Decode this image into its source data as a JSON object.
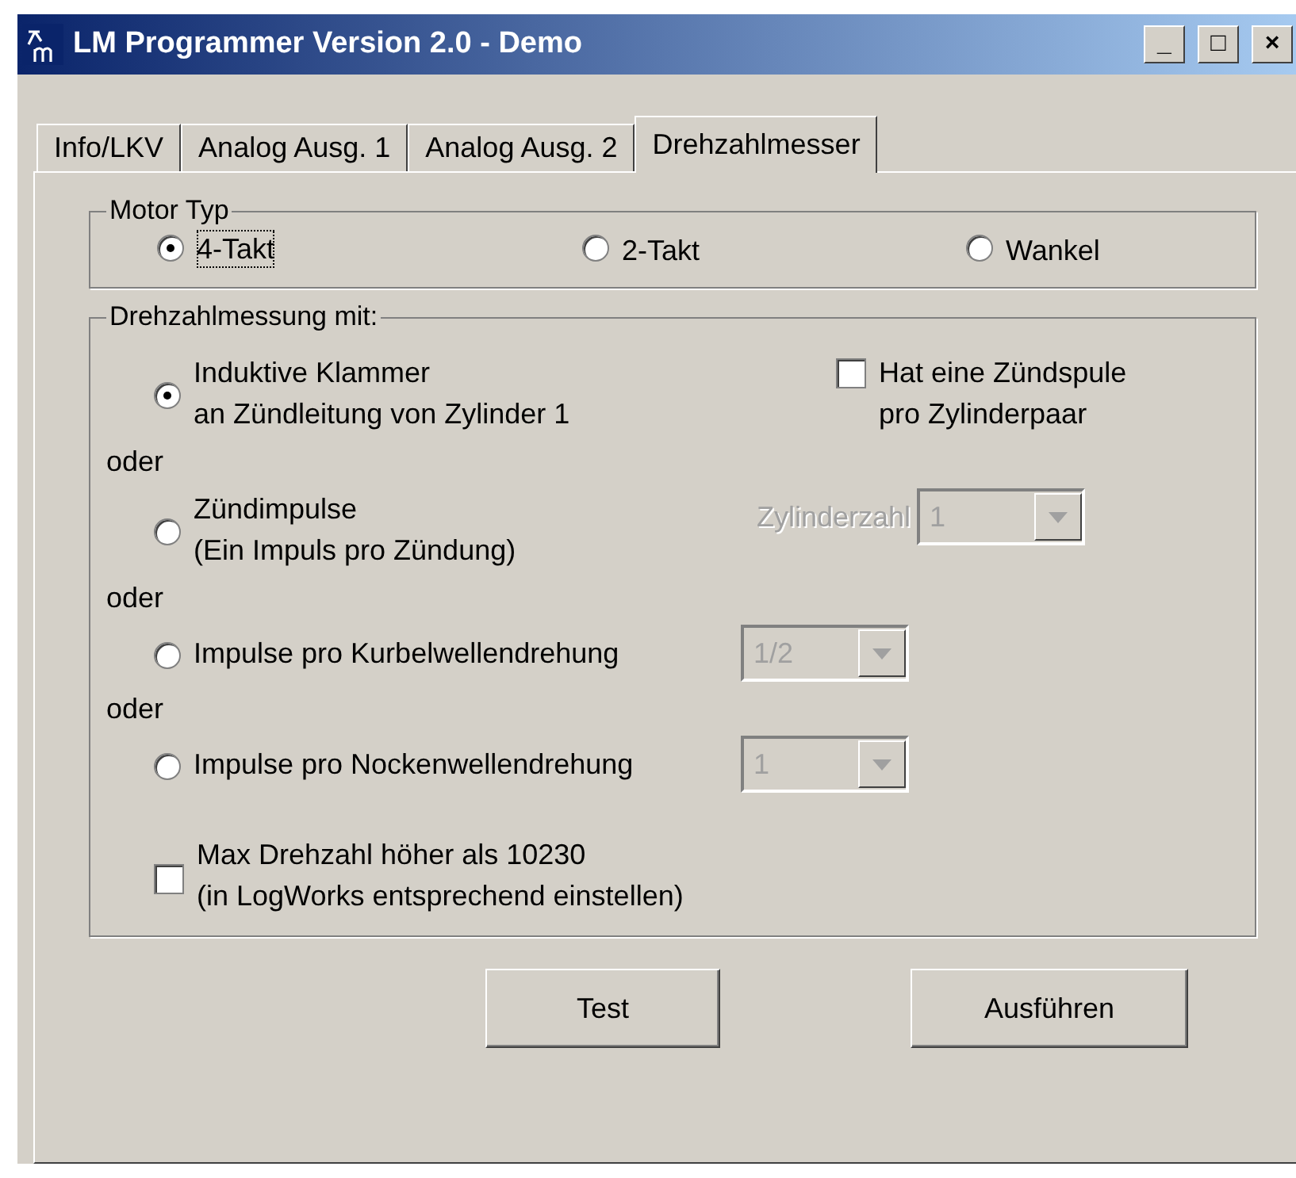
{
  "window": {
    "title": "LM Programmer Version 2.0 - Demo",
    "controls": [
      "_",
      "□",
      "×"
    ]
  },
  "tabs": [
    {
      "label": "Info/LKV",
      "selected": false
    },
    {
      "label": "Analog Ausg. 1",
      "selected": false
    },
    {
      "label": "Analog Ausg. 2",
      "selected": false
    },
    {
      "label": "Drehzahlmesser",
      "selected": true
    }
  ],
  "motor_type": {
    "legend": "Motor Typ",
    "options": [
      {
        "label": "4-Takt",
        "selected": true
      },
      {
        "label": "2-Takt",
        "selected": false
      },
      {
        "label": "Wankel",
        "selected": false
      }
    ]
  },
  "measurement": {
    "legend": "Drehzahlmessung mit:",
    "items": [
      {
        "kind": "radio",
        "lines": [
          "Induktive Klammer",
          "an Zündleitung von Zylinder 1"
        ],
        "selected": true,
        "extra": {
          "kind": "checkbox",
          "lines": [
            "Hat eine Zündspule",
            "pro Zylinderpaar"
          ],
          "checked": false
        }
      },
      {
        "kind": "separator",
        "label": "oder"
      },
      {
        "kind": "radio",
        "lines": [
          "Zündimpulse",
          "(Ein Impuls pro Zündung)"
        ],
        "selected": false,
        "extra": {
          "kind": "combo",
          "label": "Zylinderzahl",
          "value": "1",
          "disabled": true
        }
      },
      {
        "kind": "separator",
        "label": "oder"
      },
      {
        "kind": "radio",
        "lines": [
          "Impulse pro Kurbelwellendrehung"
        ],
        "selected": false,
        "extra": {
          "kind": "combo",
          "value": "1/2",
          "disabled": true
        }
      },
      {
        "kind": "separator",
        "label": "oder"
      },
      {
        "kind": "radio",
        "lines": [
          "Impulse pro Nockenwellendrehung"
        ],
        "selected": false,
        "extra": {
          "kind": "combo",
          "value": "1",
          "disabled": true
        }
      },
      {
        "kind": "checkbox",
        "lines": [
          "Max Drehzahl höher als 10230",
          "(in LogWorks entsprechend einstellen)"
        ],
        "checked": false
      }
    ]
  },
  "buttons": [
    "Test",
    "Ausführen"
  ]
}
